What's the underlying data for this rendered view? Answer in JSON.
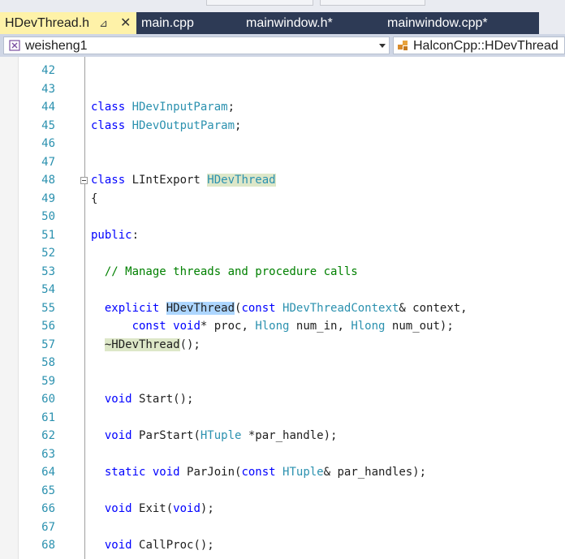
{
  "tabs": [
    {
      "label": "HDevThread.h",
      "active": true,
      "pin": "⊿",
      "close": "✕"
    },
    {
      "label": "main.cpp",
      "active": false
    },
    {
      "label": "mainwindow.h*",
      "active": false
    },
    {
      "label": "mainwindow.cpp*",
      "active": false
    }
  ],
  "nav": {
    "scope": "weisheng1",
    "member": "HalconCpp::HDevThread"
  },
  "colors": {
    "keyword": "#0000ff",
    "type": "#2b91af",
    "comment": "#008000",
    "active_tab": "#fef2a8",
    "tab_strip": "#2d3a55"
  },
  "editor": {
    "lines": [
      {
        "n": "42",
        "segs": []
      },
      {
        "n": "43",
        "segs": []
      },
      {
        "n": "44",
        "segs": [
          {
            "t": "class ",
            "c": "kw"
          },
          {
            "t": "HDevInputParam",
            "c": "ty"
          },
          {
            "t": ";",
            "c": ""
          }
        ]
      },
      {
        "n": "45",
        "segs": [
          {
            "t": "class ",
            "c": "kw"
          },
          {
            "t": "HDevOutputParam",
            "c": "ty"
          },
          {
            "t": ";",
            "c": ""
          }
        ]
      },
      {
        "n": "46",
        "segs": []
      },
      {
        "n": "47",
        "segs": []
      },
      {
        "n": "48",
        "fold": true,
        "segs": [
          {
            "t": "class ",
            "c": "kw"
          },
          {
            "t": "LIntExport ",
            "c": ""
          },
          {
            "t": "HDevThread",
            "c": "ty hl2"
          }
        ]
      },
      {
        "n": "49",
        "segs": [
          {
            "t": "{",
            "c": ""
          }
        ]
      },
      {
        "n": "50",
        "segs": []
      },
      {
        "n": "51",
        "segs": [
          {
            "t": "public",
            "c": "kw"
          },
          {
            "t": ":",
            "c": ""
          }
        ]
      },
      {
        "n": "52",
        "segs": []
      },
      {
        "n": "53",
        "segs": [
          {
            "t": "  // Manage threads and procedure calls",
            "c": "cm"
          }
        ]
      },
      {
        "n": "54",
        "segs": []
      },
      {
        "n": "55",
        "segs": [
          {
            "t": "  explicit ",
            "c": "kw"
          },
          {
            "t": "HDevThread",
            "c": "hl"
          },
          {
            "t": "(",
            "c": ""
          },
          {
            "t": "const ",
            "c": "kw"
          },
          {
            "t": "HDevThreadContext",
            "c": "ty"
          },
          {
            "t": "& context,",
            "c": ""
          }
        ]
      },
      {
        "n": "56",
        "segs": [
          {
            "t": "      const ",
            "c": "kw"
          },
          {
            "t": "void",
            "c": "kw"
          },
          {
            "t": "* proc, ",
            "c": ""
          },
          {
            "t": "Hlong",
            "c": "ty"
          },
          {
            "t": " num_in, ",
            "c": ""
          },
          {
            "t": "Hlong",
            "c": "ty"
          },
          {
            "t": " num_out);",
            "c": ""
          }
        ]
      },
      {
        "n": "57",
        "segs": [
          {
            "t": "  ",
            "c": ""
          },
          {
            "t": "~HDevThread",
            "c": "hl2"
          },
          {
            "t": "();",
            "c": ""
          }
        ]
      },
      {
        "n": "58",
        "segs": []
      },
      {
        "n": "59",
        "segs": []
      },
      {
        "n": "60",
        "segs": [
          {
            "t": "  void ",
            "c": "kw"
          },
          {
            "t": "Start();",
            "c": ""
          }
        ]
      },
      {
        "n": "61",
        "segs": []
      },
      {
        "n": "62",
        "segs": [
          {
            "t": "  void ",
            "c": "kw"
          },
          {
            "t": "ParStart(",
            "c": ""
          },
          {
            "t": "HTuple",
            "c": "ty"
          },
          {
            "t": " *par_handle);",
            "c": ""
          }
        ]
      },
      {
        "n": "63",
        "segs": []
      },
      {
        "n": "64",
        "segs": [
          {
            "t": "  static ",
            "c": "kw"
          },
          {
            "t": "void ",
            "c": "kw"
          },
          {
            "t": "ParJoin(",
            "c": ""
          },
          {
            "t": "const ",
            "c": "kw"
          },
          {
            "t": "HTuple",
            "c": "ty"
          },
          {
            "t": "& par_handles);",
            "c": ""
          }
        ]
      },
      {
        "n": "65",
        "segs": []
      },
      {
        "n": "66",
        "segs": [
          {
            "t": "  void ",
            "c": "kw"
          },
          {
            "t": "Exit(",
            "c": ""
          },
          {
            "t": "void",
            "c": "kw"
          },
          {
            "t": ");",
            "c": ""
          }
        ]
      },
      {
        "n": "67",
        "segs": []
      },
      {
        "n": "68",
        "segs": [
          {
            "t": "  void ",
            "c": "kw"
          },
          {
            "t": "CallProc();",
            "c": ""
          }
        ]
      }
    ]
  }
}
